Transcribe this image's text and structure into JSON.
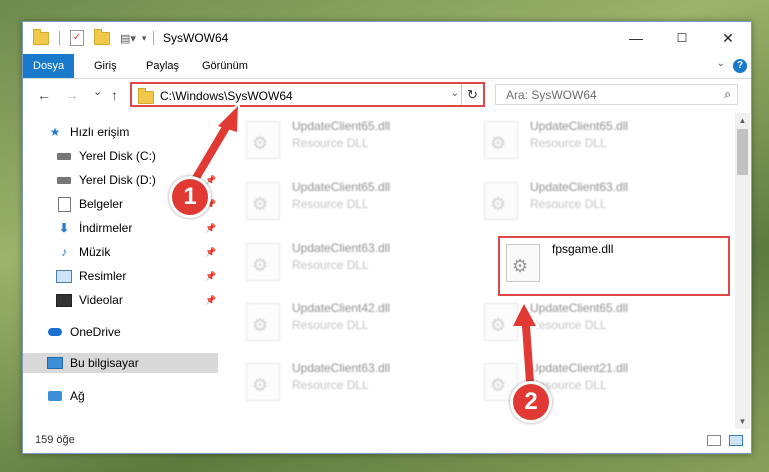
{
  "window": {
    "title": "SysWOW64",
    "min": "—",
    "max": "☐",
    "close": "✕"
  },
  "ribbon": {
    "tabs": [
      {
        "label": "Dosya",
        "active": true
      },
      {
        "label": "Giriş"
      },
      {
        "label": "Paylaş"
      },
      {
        "label": "Görünüm"
      }
    ],
    "help": "?"
  },
  "nav": {
    "back": "←",
    "forward": "→",
    "recent": "⌄",
    "up": "↑",
    "address": "C:\\Windows\\SysWOW64",
    "refresh": "↻",
    "search_placeholder": "Ara: SysWOW64"
  },
  "sidebar": {
    "items": [
      {
        "label": "Hızlı erişim",
        "icon": "star-icon"
      },
      {
        "label": "Yerel Disk (C:)",
        "icon": "drive-icon"
      },
      {
        "label": "Yerel Disk (D:)",
        "icon": "drive-icon",
        "pinned": true
      },
      {
        "label": "Belgeler",
        "icon": "document-icon",
        "pinned": true
      },
      {
        "label": "İndirmeler",
        "icon": "download-icon",
        "pinned": true
      },
      {
        "label": "Müzik",
        "icon": "music-icon",
        "pinned": true
      },
      {
        "label": "Resimler",
        "icon": "pictures-icon",
        "pinned": true
      },
      {
        "label": "Videolar",
        "icon": "videos-icon",
        "pinned": true
      },
      {
        "label": "OneDrive",
        "icon": "onedrive-icon"
      },
      {
        "label": "Bu bilgisayar",
        "icon": "computer-icon",
        "selected": true
      },
      {
        "label": "Ağ",
        "icon": "network-icon"
      }
    ]
  },
  "files": [
    {
      "name": "UpdateClient65.dll",
      "type": "Resource DLL"
    },
    {
      "name": "UpdateClient65.dll",
      "type": "Resource DLL"
    },
    {
      "name": "UpdateClient65.dll",
      "type": "Resource DLL"
    },
    {
      "name": "UpdateClient63.dll",
      "type": "Resource DLL"
    },
    {
      "name": "UpdateClient63.dll",
      "type": "Resource DLL"
    },
    {
      "name": "fpsgame.dll",
      "type": ""
    },
    {
      "name": "UpdateClient42.dll",
      "type": "Resource DLL"
    },
    {
      "name": "UpdateClient65.dll",
      "type": "Resource DLL"
    },
    {
      "name": "UpdateClient63.dll",
      "type": "Resource DLL"
    },
    {
      "name": "UpdateClient21.dll",
      "type": "Resource DLL"
    }
  ],
  "status": {
    "count": "159 öğe"
  },
  "callouts": {
    "one": "1",
    "two": "2",
    "color": "#e13a35"
  }
}
